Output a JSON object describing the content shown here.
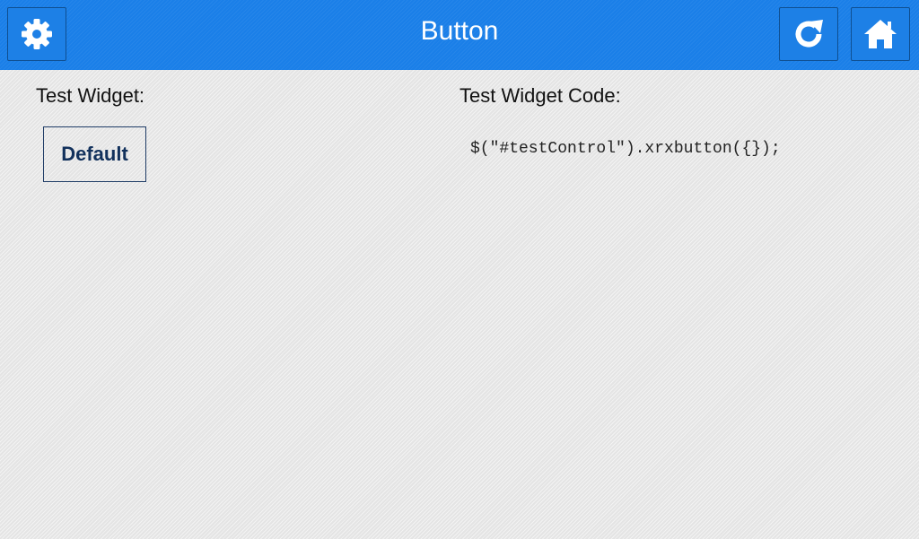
{
  "header": {
    "title": "Button",
    "settings_icon": "gear-icon",
    "refresh_icon": "refresh-icon",
    "home_icon": "home-icon"
  },
  "main": {
    "widget_label": "Test Widget:",
    "widget_button_label": "Default",
    "code_label": "Test Widget Code:",
    "code": "$(\"#testControl\").xrxbutton({});"
  },
  "colors": {
    "header_bg": "#1a7fe8",
    "page_bg": "#e4e4e4",
    "button_text": "#12315c"
  }
}
